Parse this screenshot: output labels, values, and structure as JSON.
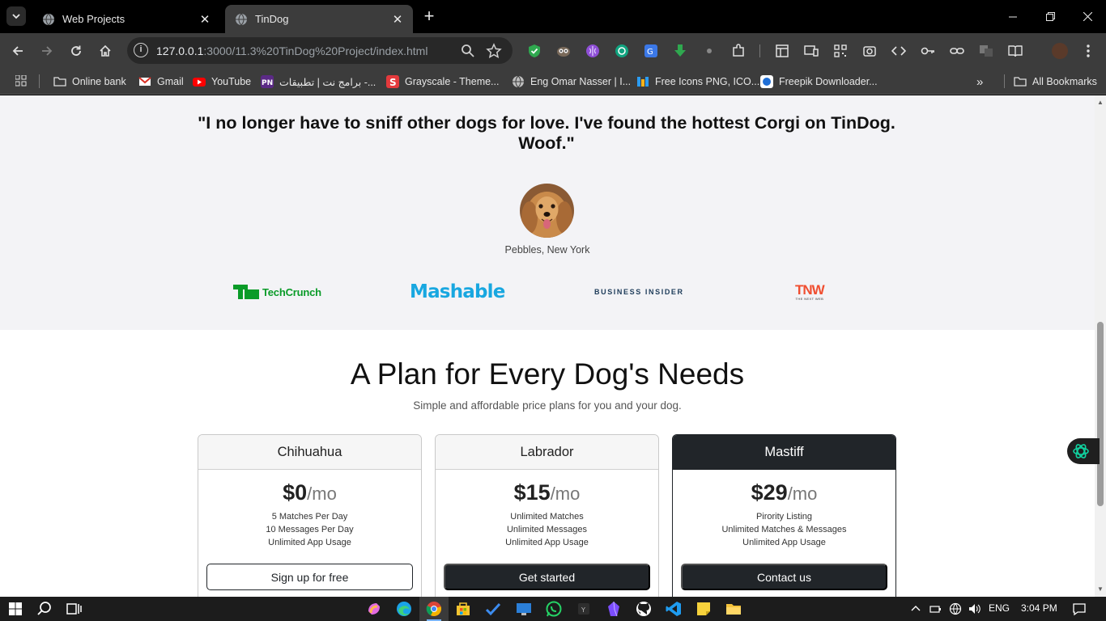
{
  "browser": {
    "tabs": [
      {
        "title": "Web Projects",
        "active": false
      },
      {
        "title": "TinDog",
        "active": true
      }
    ],
    "url_host": "127.0.0.1",
    "url_rest": ":3000/11.3%20TinDog%20Project/index.html",
    "bookmarks": [
      {
        "label": "Online bank",
        "icon": "folder-icon"
      },
      {
        "label": "Gmail",
        "icon": "gmail-icon"
      },
      {
        "label": "YouTube",
        "icon": "youtube-icon"
      },
      {
        "label": "برامج نت | تطبيقات -...",
        "icon": "pn-icon"
      },
      {
        "label": "Grayscale - Theme...",
        "icon": "grayscale-icon"
      },
      {
        "label": "Eng Omar Nasser | I...",
        "icon": "globe-icon"
      },
      {
        "label": "Free Icons PNG, ICO...",
        "icon": "icons-icon"
      },
      {
        "label": "Freepik Downloader...",
        "icon": "freepik-icon"
      }
    ],
    "all_bookmarks": "All Bookmarks"
  },
  "testimonial": {
    "quote": "\"I no longer have to sniff other dogs for love. I've found the hottest Corgi on TinDog. Woof.\"",
    "author": "Pebbles, New York"
  },
  "press": {
    "techcrunch": "TechCrunch",
    "mashable": "Mashable",
    "business_insider": "BUSINESS INSIDER",
    "tnw": "TNW",
    "tnw_sub": "THE NEXT WEB"
  },
  "pricing": {
    "title": "A Plan for Every Dog's Needs",
    "subtitle": "Simple and affordable price plans for you and your dog.",
    "plans": [
      {
        "name": "Chihuahua",
        "price": "$0",
        "per": "/mo",
        "features": [
          "5 Matches Per Day",
          "10 Messages Per Day",
          "Unlimited App Usage"
        ],
        "cta": "Sign up for free"
      },
      {
        "name": "Labrador",
        "price": "$15",
        "per": "/mo",
        "features": [
          "Unlimited Matches",
          "Unlimited Messages",
          "Unlimited App Usage"
        ],
        "cta": "Get started"
      },
      {
        "name": "Mastiff",
        "price": "$29",
        "per": "/mo",
        "features": [
          "Pirority Listing",
          "Unlimited Matches & Messages",
          "Unlimited App Usage"
        ],
        "cta": "Contact us"
      }
    ]
  },
  "taskbar": {
    "language": "ENG",
    "time": "3:04 PM"
  },
  "colors": {
    "accent_dark": "#212529",
    "testimonial_bg": "#f3f3f6",
    "mashable_blue": "#18a7e0",
    "techcrunch_green": "#0a9b28",
    "tnw_red": "#f04e30"
  }
}
